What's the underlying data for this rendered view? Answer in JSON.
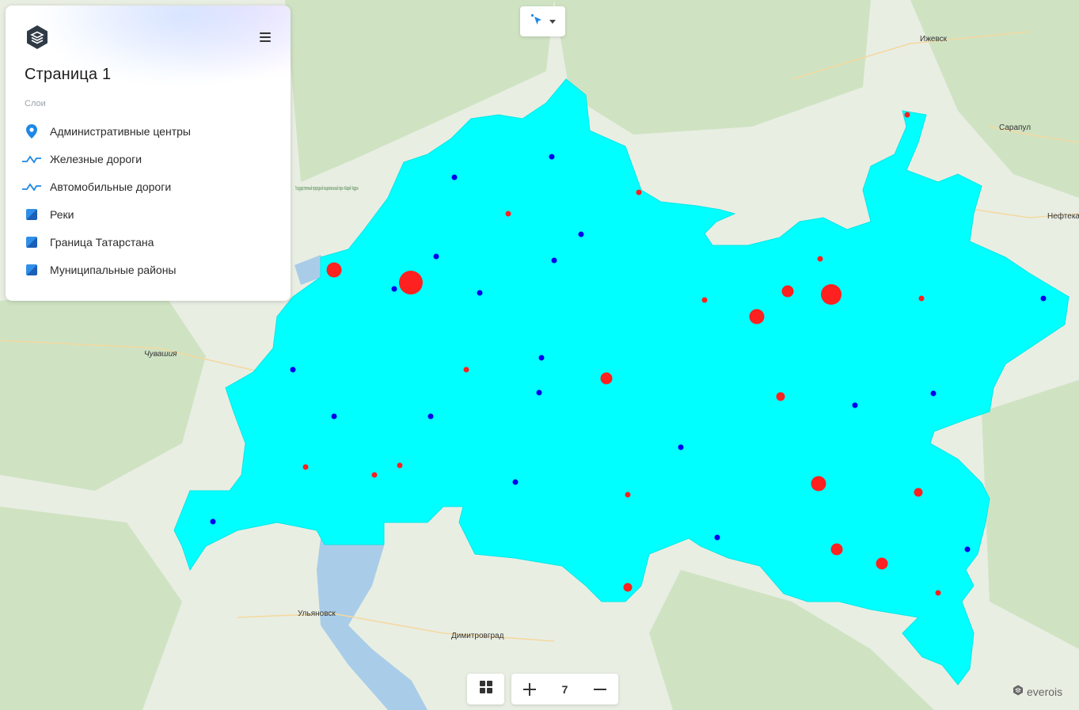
{
  "panel": {
    "page_title": "Страница 1",
    "layers_heading": "Слои",
    "layers": [
      {
        "label": "Административные центры",
        "icon": "location-pin-icon"
      },
      {
        "label": "Железные дороги",
        "icon": "polyline-icon"
      },
      {
        "label": "Автомобильные дороги",
        "icon": "polyline-icon"
      },
      {
        "label": "Реки",
        "icon": "polygon-icon"
      },
      {
        "label": "Граница Татарстана",
        "icon": "polygon-icon"
      },
      {
        "label": "Муниципальные районы",
        "icon": "polygon-icon"
      }
    ]
  },
  "map": {
    "zoom_level": "7",
    "region_color": "#00ffff",
    "marker_colors": {
      "admin_center": "#ff2020",
      "settlement": "#0000ee"
    },
    "place_labels": {
      "izhevsk": "Ижевск",
      "sarapul": "Сарапул",
      "neftekamsk": "Нефтекам",
      "chuvashia": "Чувашия",
      "ulyanovsk": "Ульяновск",
      "dimitrovgrad": "Димитровград",
      "mari_park": "Государственный природный национальный парк «Марий Чодра»"
    }
  },
  "attribution": {
    "brand": "everois"
  }
}
